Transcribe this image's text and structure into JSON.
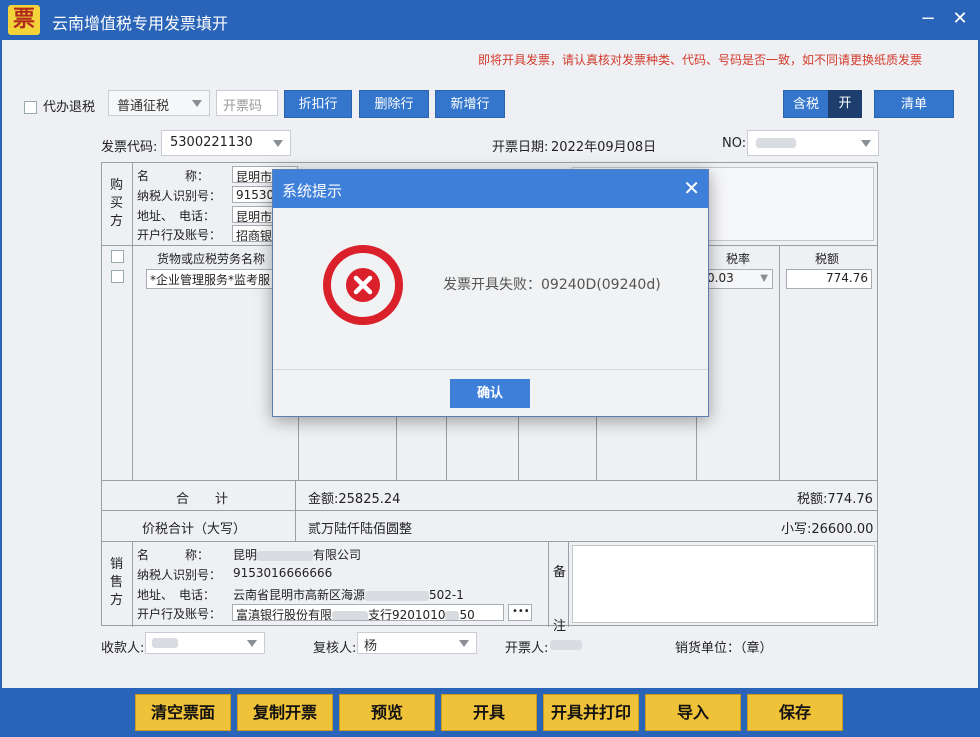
{
  "window": {
    "logo_char": "票",
    "title": "云南增值税专用发票填开",
    "minimize": "−",
    "close": "✕"
  },
  "warning": "即将开具发票，请认真核对发票种类、代码、号码是否一致，如不同请更换纸质发票",
  "toolbar": {
    "proxy_refund_label": "代办退税",
    "tax_type": "普通征税",
    "invoice_code_placeholder": "开票码",
    "discount_row": "折扣行",
    "delete_row": "删除行",
    "add_row": "新增行",
    "tax_inclusive": "含税",
    "tax_inclusive_state": "开",
    "clear": "清单"
  },
  "header": {
    "code_label": "发票代码:",
    "code_value": "5300221130",
    "date_label": "开票日期:",
    "date_value": "2022年09月08日",
    "no_label": "NO:"
  },
  "buyer": {
    "section": [
      "购",
      "买",
      "方"
    ],
    "name_label": "名　　　称：",
    "name_value": "昆明市",
    "tax_id_label": "纳税人识别号：",
    "tax_id_value": "91530",
    "address_label": "地址、　电话：",
    "address_value": "昆明市",
    "bank_label": "开户行及账号：",
    "bank_value": "招商银"
  },
  "goods": {
    "col_name": "货物或应税劳务名称",
    "col_rate": "税率",
    "col_tax": "税额",
    "row1_name": "*企业管理服务*监考服",
    "row1_rate": "0.03",
    "row1_tax": "774.76"
  },
  "totals": {
    "sum_label": "合　　计",
    "amount": "金额:25825.24",
    "tax": "税额:774.76",
    "total_label": "价税合计（大写）",
    "total_words": "贰万陆仟陆佰圆整",
    "total_small": "小写:26600.00"
  },
  "seller": {
    "section": [
      "销",
      "售",
      "方"
    ],
    "name_label": "名　　　称：",
    "name_value": "昆明",
    "name_tail": "有限公司",
    "tax_id_label": "纳税人识别号：",
    "tax_id_value": "9153016666666",
    "address_label": "地址、　电话：",
    "address_value": "云南省昆明市高新区海源",
    "address_tail": "502-1",
    "bank_label": "开户行及账号：",
    "bank_value": "富滇银行股份有限",
    "bank_tail": "支行9201010",
    "bank_suffix": "50",
    "more": "•••"
  },
  "remarks": [
    "备",
    "注"
  ],
  "signatures": {
    "payee_label": "收款人:",
    "reviewer_label": "复核人:",
    "reviewer_value": "杨",
    "issuer_label": "开票人:",
    "seller_unit": "销货单位：（章）"
  },
  "bottom_buttons": [
    "清空票面",
    "复制开票",
    "预览",
    "开具",
    "开具并打印",
    "导入",
    "保存"
  ],
  "dialog": {
    "title": "系统提示",
    "close": "✕",
    "message": "发票开具失败：09240D(09240d)",
    "ok": "确认"
  },
  "colors": {
    "titlebar": "#2a64b8",
    "primary_button": "#3476cc",
    "bottom_button": "#f0c23a",
    "error_icon": "#d9202b",
    "warning_text": "#d33b2c"
  }
}
